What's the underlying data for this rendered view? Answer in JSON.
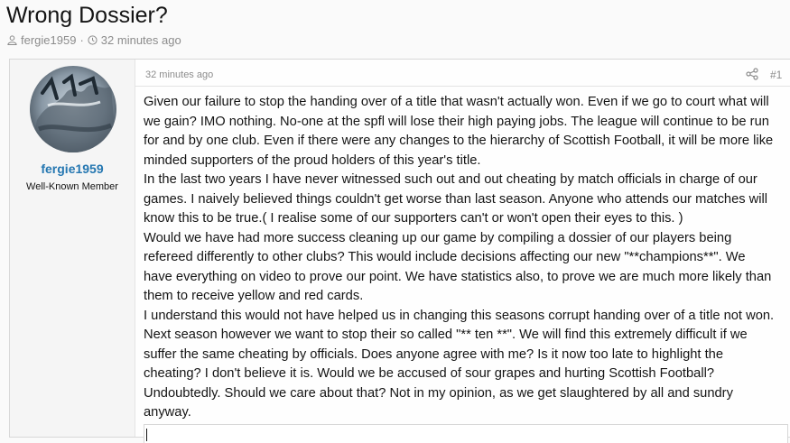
{
  "thread": {
    "title": "Wrong Dossier?",
    "author": "fergie1959",
    "separator": "·",
    "time": "32 minutes ago"
  },
  "post": {
    "username": "fergie1959",
    "user_title": "Well-Known Member",
    "date": "32 minutes ago",
    "number": "#1",
    "paragraphs": [
      "Given our failure to stop the handing over of a title that wasn't actually won. Even if we go to court what will we gain? IMO nothing. No-one at the spfl will lose their high paying jobs. The league will continue to be run for and by one club. Even if there were any changes to the hierarchy of Scottish Football, it will be more like minded supporters of the proud holders of this year's title.",
      "In the last two years I have never witnessed such out and out cheating by match officials in charge of our games. I naively believed things couldn't get worse than last season. Anyone who attends our matches will know this to be true.( I realise some of our supporters can't or won't open their eyes to this. )",
      "Would we have had more success cleaning up our game by compiling a dossier of our players being refereed differently to other clubs? This would include decisions affecting our new \"**champions**\". We have everything on video to prove our point. We have statistics also, to prove we are much more likely than them to receive yellow and red cards.",
      "I understand this would not have helped us in changing this seasons corrupt handing over of a title not won. Next season however we want to stop their so called \"** ten **\". We will find this extremely difficult if we suffer the same cheating by officials. Does anyone agree with me? Is it now too late to highlight the cheating? I don't believe it is. Would we be accused of sour grapes and hurting Scottish Football? Undoubtedly. Should we care about that? Not in my opinion, as we get slaughtered by all and sundry anyway."
    ]
  },
  "icons": {
    "author": "user-icon",
    "time": "clock-icon",
    "share": "share-icon",
    "avatar": "avatar-image"
  },
  "colors": {
    "accent": "#2577b1",
    "muted": "#8c8c8c",
    "text": "#141414"
  }
}
